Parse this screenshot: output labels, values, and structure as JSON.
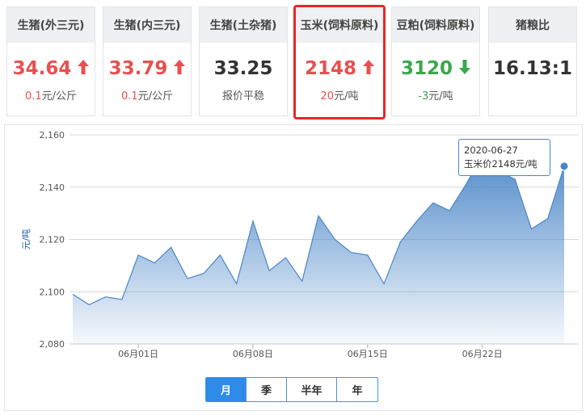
{
  "cards": [
    {
      "title": "生猪(外三元)",
      "value": "34.64",
      "trend": "up",
      "change_num": "0.1",
      "change_unit": "元/公斤",
      "note": ""
    },
    {
      "title": "生猪(内三元)",
      "value": "33.79",
      "trend": "up",
      "change_num": "0.1",
      "change_unit": "元/公斤",
      "note": ""
    },
    {
      "title": "生猪(土杂猪)",
      "value": "33.25",
      "trend": "flat",
      "change_num": "",
      "change_unit": "",
      "note": "报价平稳"
    },
    {
      "title": "玉米(饲料原料)",
      "value": "2148",
      "trend": "up",
      "change_num": "20",
      "change_unit": "元/吨",
      "note": ""
    },
    {
      "title": "豆粕(饲料原料)",
      "value": "3120",
      "trend": "down",
      "change_num": "-3",
      "change_unit": "元/吨",
      "note": ""
    },
    {
      "title": "猪粮比",
      "value": "16.13:1",
      "trend": "flat",
      "change_num": "",
      "change_unit": "",
      "note": ""
    }
  ],
  "selected_card_index": 3,
  "icons": {
    "up": "arrow-up-icon",
    "down": "arrow-down-icon"
  },
  "colors": {
    "up": "#e8504f",
    "down": "#3aa74b",
    "selected_border": "#e52727",
    "series": "#4a86c8",
    "active_tab": "#2f8be8"
  },
  "tooltip": {
    "date": "2020-06-27",
    "label": "玉米价2148元/吨"
  },
  "range_tabs": [
    {
      "label": "月",
      "active": true
    },
    {
      "label": "季",
      "active": false
    },
    {
      "label": "半年",
      "active": false
    },
    {
      "label": "年",
      "active": false
    }
  ],
  "chart_data": {
    "type": "area",
    "title": "",
    "ylabel": "元/吨",
    "xlabel": "",
    "ylim": [
      2080,
      2160
    ],
    "y_ticks": [
      2080,
      2100,
      2120,
      2140,
      2160
    ],
    "y_tick_labels": [
      "2,080",
      "2,100",
      "2,120",
      "2,140",
      "2,160"
    ],
    "x_tick_labels": [
      {
        "label": "06月01日",
        "date": "2020-06-01"
      },
      {
        "label": "06月08日",
        "date": "2020-06-08"
      },
      {
        "label": "06月15日",
        "date": "2020-06-15"
      },
      {
        "label": "06月22日",
        "date": "2020-06-22"
      }
    ],
    "grid": true,
    "series": [
      {
        "x": [
          "2020-05-28",
          "2020-05-29",
          "2020-05-30",
          "2020-05-31",
          "2020-06-01",
          "2020-06-02",
          "2020-06-03",
          "2020-06-04",
          "2020-06-05",
          "2020-06-06",
          "2020-06-07",
          "2020-06-08",
          "2020-06-09",
          "2020-06-10",
          "2020-06-11",
          "2020-06-12",
          "2020-06-13",
          "2020-06-14",
          "2020-06-15",
          "2020-06-16",
          "2020-06-17",
          "2020-06-18",
          "2020-06-19",
          "2020-06-20",
          "2020-06-21",
          "2020-06-22",
          "2020-06-23",
          "2020-06-24",
          "2020-06-25",
          "2020-06-26",
          "2020-06-27"
        ],
        "values": [
          2099,
          2095,
          2098,
          2097,
          2114,
          2111,
          2117,
          2105,
          2107,
          2114,
          2103,
          2127,
          2108,
          2113,
          2104,
          2129,
          2120,
          2115,
          2114,
          2103,
          2119,
          2127,
          2134,
          2131,
          2141,
          2152,
          2146,
          2143,
          2124,
          2128,
          2148
        ]
      }
    ],
    "highlight": {
      "x": "2020-06-27",
      "y": 2148
    }
  }
}
